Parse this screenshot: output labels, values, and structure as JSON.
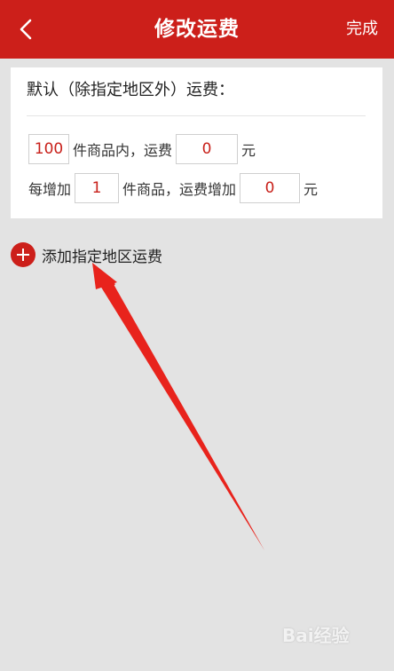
{
  "header": {
    "title": "修改运费",
    "done_label": "完成",
    "back_icon": "chevron-left-icon",
    "background": "#cc1f1a"
  },
  "default_rule": {
    "heading": "默认（除指定地区外）运费：",
    "row1": {
      "item_count": "100",
      "text_a": "件商品内，运费",
      "fee": "0",
      "unit": "元"
    },
    "row2": {
      "prefix": "每增加",
      "increment_count": "1",
      "text_a": "件商品，运费增加",
      "increment_fee": "0",
      "unit": "元"
    }
  },
  "add_region": {
    "label": "添加指定地区运费",
    "icon": "plus-circle-icon"
  },
  "colors": {
    "accent": "#cc1f1a",
    "value_text": "#c8201a"
  },
  "watermark": {
    "text": "Bai经验"
  }
}
